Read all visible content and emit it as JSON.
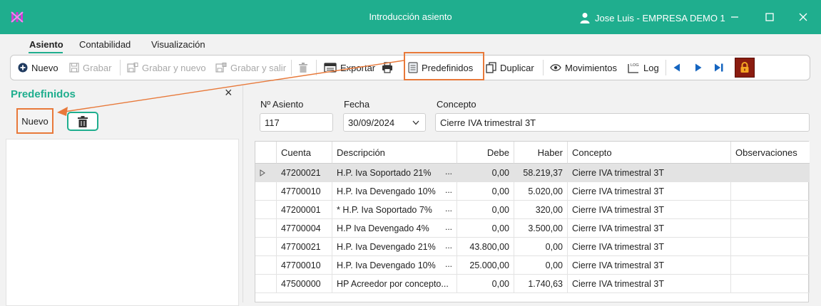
{
  "window": {
    "title": "Introducción asiento",
    "user": "Jose Luis - EMPRESA DEMO 1"
  },
  "menu": {
    "tabs": [
      "Asiento",
      "Contabilidad",
      "Visualización"
    ]
  },
  "toolbar": {
    "nuevo": "Nuevo",
    "grabar": "Grabar",
    "grabar_nuevo": "Grabar y nuevo",
    "grabar_salir": "Grabar y salir",
    "exportar": "Exportar",
    "predefinidos": "Predefinidos",
    "duplicar": "Duplicar",
    "movimientos": "Movimientos",
    "log": "Log",
    "log_icon_text": "LOG"
  },
  "panel": {
    "title": "Predefinidos",
    "close": "×",
    "nuevo": "Nuevo"
  },
  "form": {
    "asiento_label": "Nº Asiento",
    "asiento_value": "117",
    "fecha_label": "Fecha",
    "fecha_value": "30/09/2024",
    "concepto_label": "Concepto",
    "concepto_value": "Cierre IVA trimestral 3T"
  },
  "grid": {
    "headers": {
      "cuenta": "Cuenta",
      "descripcion": "Descripción",
      "debe": "Debe",
      "haber": "Haber",
      "concepto": "Concepto",
      "observaciones": "Observaciones"
    },
    "ellipsis": "...",
    "rows": [
      {
        "cuenta": "47200021",
        "descripcion": "H.P. Iva Soportado 21%",
        "debe": "0,00",
        "haber": "58.219,37",
        "concepto": "Cierre IVA trimestral 3T",
        "observaciones": ""
      },
      {
        "cuenta": "47700010",
        "descripcion": "H.P. Iva Devengado 10%",
        "debe": "0,00",
        "haber": "5.020,00",
        "concepto": "Cierre IVA trimestral 3T",
        "observaciones": ""
      },
      {
        "cuenta": "47200001",
        "descripcion": "* H.P. Iva Soportado 7%",
        "debe": "0,00",
        "haber": "320,00",
        "concepto": "Cierre IVA trimestral 3T",
        "observaciones": ""
      },
      {
        "cuenta": "47700004",
        "descripcion": "H.P Iva Devengado 4%",
        "debe": "0,00",
        "haber": "3.500,00",
        "concepto": "Cierre IVA trimestral 3T",
        "observaciones": ""
      },
      {
        "cuenta": "47700021",
        "descripcion": "H.P. Iva Devengado 21%",
        "debe": "43.800,00",
        "haber": "0,00",
        "concepto": "Cierre IVA trimestral 3T",
        "observaciones": ""
      },
      {
        "cuenta": "47700010",
        "descripcion": "H.P. Iva Devengado 10%",
        "debe": "25.000,00",
        "haber": "0,00",
        "concepto": "Cierre IVA trimestral 3T",
        "observaciones": ""
      },
      {
        "cuenta": "47500000",
        "descripcion": "HP Acreedor por concepto...",
        "debe": "0,00",
        "haber": "1.740,63",
        "concepto": "Cierre IVA trimestral 3T",
        "observaciones": ""
      }
    ]
  },
  "colors": {
    "accent": "#1fae8e",
    "highlight": "#e8793a",
    "lock_bg": "#8a1c10",
    "nav_blue": "#1565c0"
  }
}
